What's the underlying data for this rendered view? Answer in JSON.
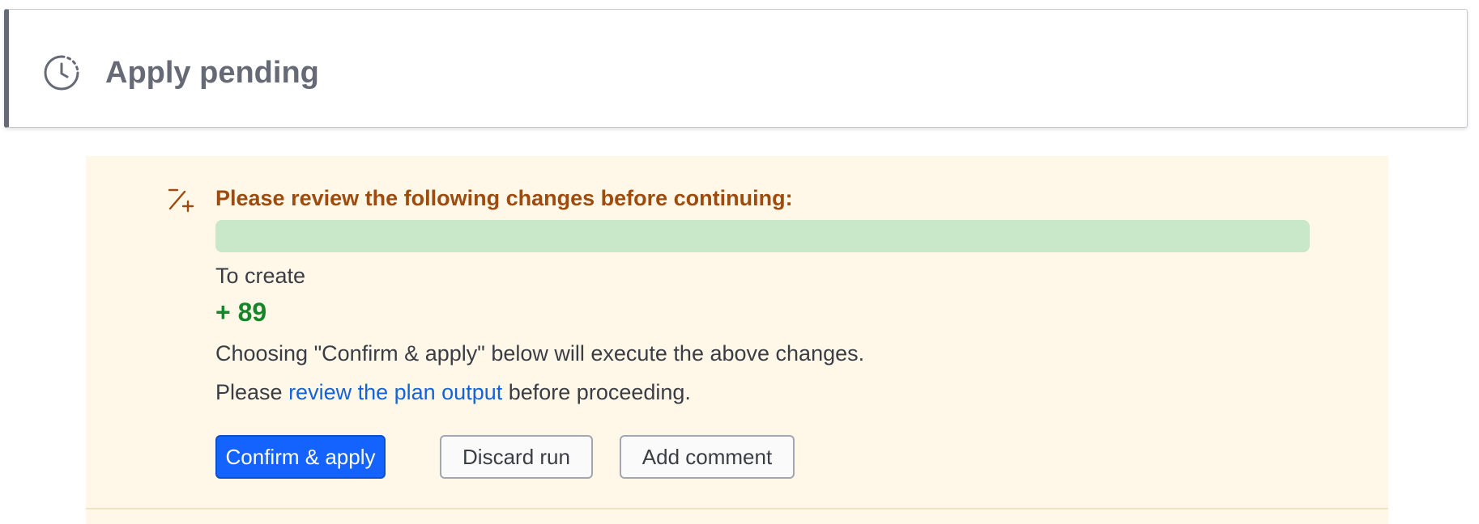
{
  "status": {
    "icon": "clock-pending-icon",
    "title": "Apply pending"
  },
  "review": {
    "icon": "diff-plus-minus-icon",
    "heading": "Please review the following changes before continuing:",
    "change_bar": {
      "create_fraction": 1.0,
      "color": "#c8e8c9"
    },
    "create_label": "To create",
    "create_count": "+ 89",
    "confirm_note": "Choosing \"Confirm & apply\" below will execute the above changes.",
    "plan_note_prefix": "Please ",
    "plan_link": "review the plan output",
    "plan_note_suffix": " before proceeding."
  },
  "actions": {
    "confirm_label": "Confirm & apply",
    "discard_label": "Discard run",
    "comment_label": "Add comment"
  },
  "colors": {
    "accent": "#1563ff",
    "warning_text": "#9e4b0e",
    "success_text": "#16862a",
    "panel_background": "#fff8e8",
    "link": "#1563d8"
  }
}
